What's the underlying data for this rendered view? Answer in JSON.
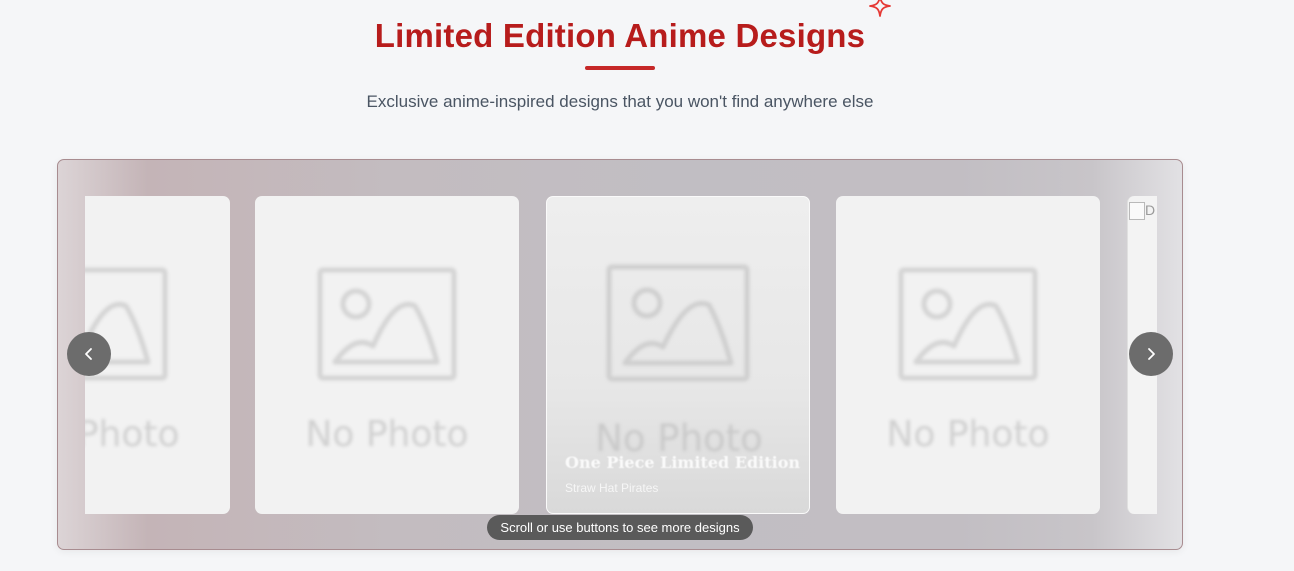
{
  "header": {
    "title": "Limited Edition Anime Designs",
    "subtitle": "Exclusive anime-inspired designs that you won't find anywhere else",
    "accent_color": "#b71c1c",
    "sparkle_icon": "sparkle-icon"
  },
  "carousel": {
    "placeholder_text": "No Photo",
    "partial_placeholder_text": "Photo",
    "featured": {
      "title": "One Piece Limited Edition",
      "subtitle": "Straw Hat Pirates"
    },
    "broken_image_alt": "D",
    "prev_icon": "chevron-left-icon",
    "next_icon": "chevron-right-icon",
    "hint": "Scroll or use buttons to see more designs"
  }
}
